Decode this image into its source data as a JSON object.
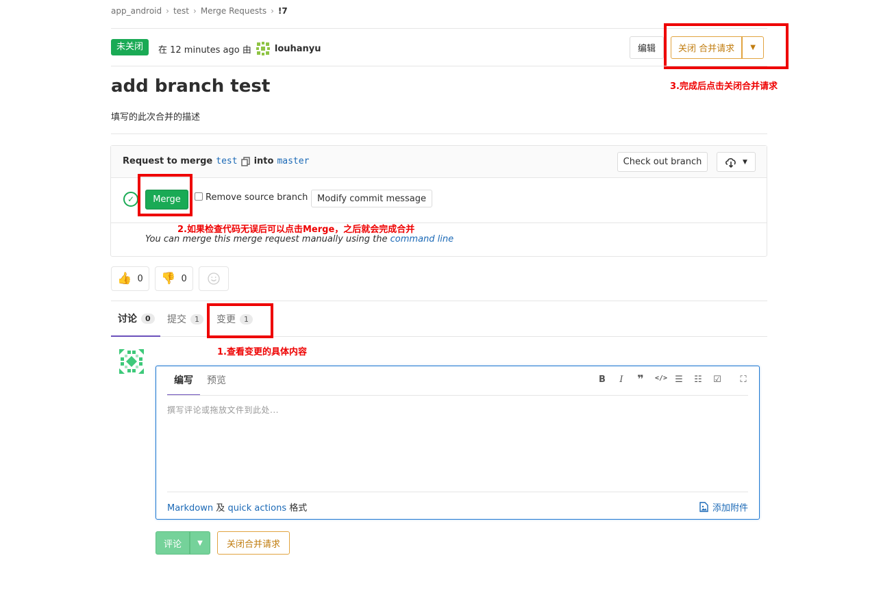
{
  "breadcrumb": {
    "items": [
      "app_android",
      "test",
      "Merge Requests"
    ],
    "current": "!7"
  },
  "header": {
    "status": "未关闭",
    "time_prefix": "在 12 minutes ago 由",
    "author": "louhanyu",
    "edit_label": "编辑",
    "close_mr_label": "关闭 合并请求"
  },
  "annotations": {
    "step3": "3.完成后点击关闭合并请求",
    "step2": "2.如果检查代码无误后可以点击Merge，之后就会完成合并",
    "step1": "1.查看变更的具体内容"
  },
  "mr": {
    "title": "add branch test",
    "description": "填写的此次合并的描述"
  },
  "widget": {
    "request_prefix": "Request to merge",
    "source_branch": "test",
    "into_label": "into",
    "target_branch": "master",
    "checkout_label": "Check out branch",
    "merge_label": "Merge",
    "remove_source_label": "Remove source branch",
    "modify_commit_label": "Modify commit message",
    "manual_text": "You can merge this merge request manually using the",
    "command_line_link": "command line"
  },
  "awards": {
    "thumbsup_count": "0",
    "thumbsdown_count": "0"
  },
  "tabs": [
    {
      "label": "讨论",
      "count": "0"
    },
    {
      "label": "提交",
      "count": "1"
    },
    {
      "label": "变更",
      "count": "1"
    }
  ],
  "editor": {
    "write_tab": "编写",
    "preview_tab": "预览",
    "placeholder": "撰写评论或拖放文件到此处...",
    "markdown_link": "Markdown",
    "and_text": "及",
    "quick_actions_link": "quick actions",
    "format_text": "格式",
    "attach_label": "添加附件"
  },
  "actions": {
    "comment_label": "评论",
    "close_mr_label": "关闭合并请求"
  },
  "colors": {
    "success": "#1aaa55",
    "warning": "#e1a33f",
    "link": "#1b69b6",
    "active_tab": "#6b4fbb",
    "annotation": "#ee0000"
  }
}
